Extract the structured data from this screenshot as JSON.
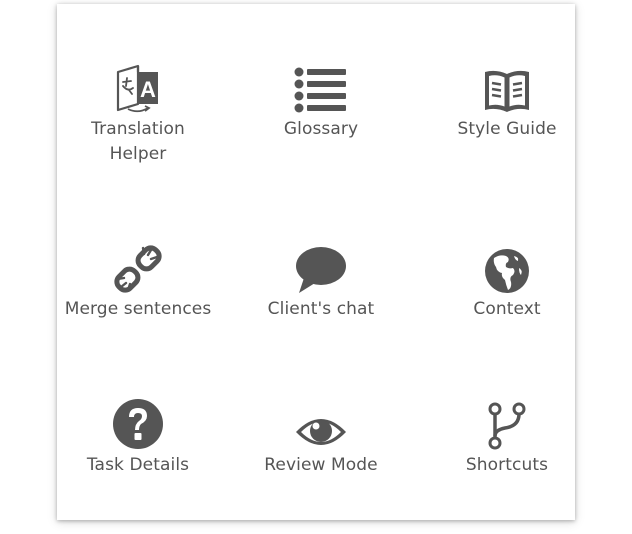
{
  "menu": {
    "items": [
      {
        "label": "Translation\nHelper",
        "icon": "translation-icon"
      },
      {
        "label": "Glossary",
        "icon": "list-icon"
      },
      {
        "label": "Style Guide",
        "icon": "book-icon"
      },
      {
        "label": "Merge sentences",
        "icon": "broken-link-icon"
      },
      {
        "label": "Client's chat",
        "icon": "chat-bubble-icon"
      },
      {
        "label": "Context",
        "icon": "globe-icon"
      },
      {
        "label": "Task Details",
        "icon": "question-circle-icon"
      },
      {
        "label": "Review Mode",
        "icon": "eye-icon"
      },
      {
        "label": "Shortcuts",
        "icon": "code-fork-icon"
      }
    ]
  },
  "colors": {
    "icon": "#555555",
    "label": "#555555",
    "background": "#ffffff"
  }
}
